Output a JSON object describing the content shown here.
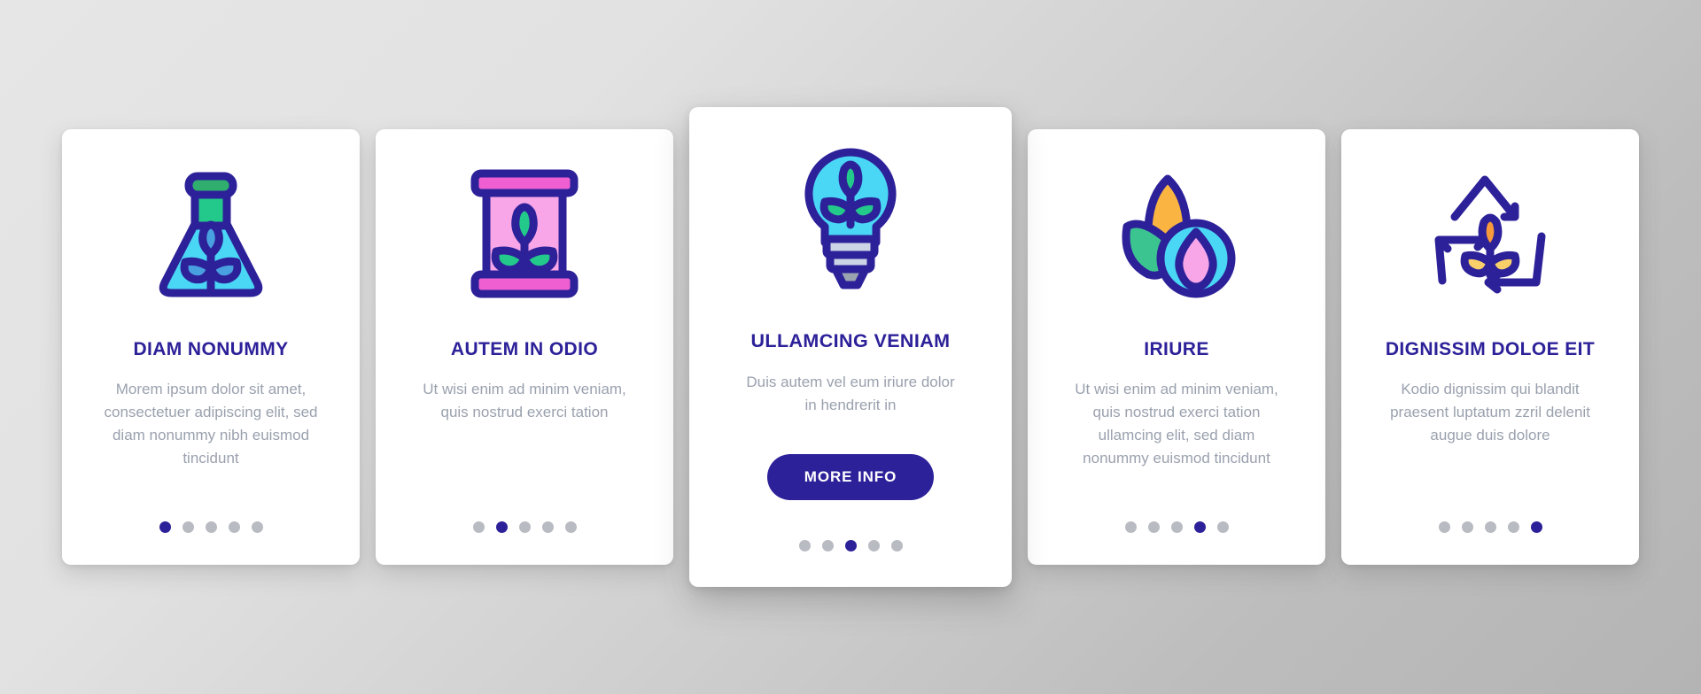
{
  "theme": {
    "accent": "#2d2199",
    "body_text": "#9aa1ae",
    "dot_inactive": "#b8bbc2",
    "card_bg": "#ffffff",
    "page_bg": "#d4d4d4"
  },
  "cards": [
    {
      "icon": "flask-plant-icon",
      "title": "DIAM NONUMMY",
      "body": "Morem ipsum dolor sit amet, consectetuer adipiscing elit, sed diam nonummy nibh euismod tincidunt",
      "featured": false,
      "dots": {
        "count": 5,
        "active": 0
      }
    },
    {
      "icon": "barrel-plant-icon",
      "title": "AUTEM IN ODIO",
      "body": "Ut wisi enim ad minim veniam, quis nostrud exerci tation",
      "featured": false,
      "dots": {
        "count": 5,
        "active": 1
      }
    },
    {
      "icon": "lightbulb-plant-icon",
      "title": "ULLAMCING VENIAM",
      "body": "Duis autem vel eum iriure dolor in hendrerit in",
      "featured": true,
      "cta_label": "MORE INFO",
      "dots": {
        "count": 5,
        "active": 2
      }
    },
    {
      "icon": "corn-droplet-icon",
      "title": "IRIURE",
      "body": "Ut wisi enim ad minim veniam, quis nostrud exerci tation ullamcing elit, sed diam nonummy euismod tincidunt",
      "featured": false,
      "dots": {
        "count": 5,
        "active": 3
      }
    },
    {
      "icon": "recycle-plant-icon",
      "title": "DIGNISSIM DOLOE EIT",
      "body": "Kodio dignissim qui blandit praesent luptatum zzril delenit augue duis dolore",
      "featured": false,
      "dots": {
        "count": 5,
        "active": 4
      }
    }
  ]
}
